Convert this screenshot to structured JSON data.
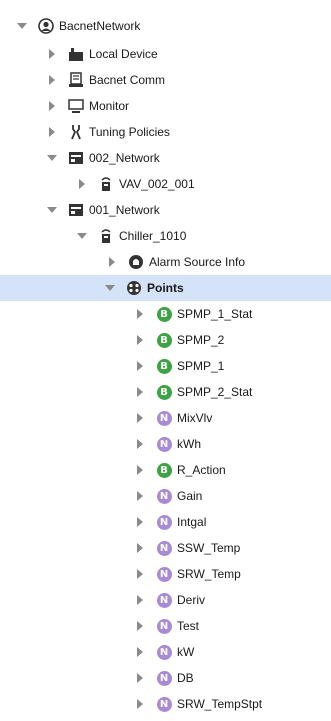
{
  "tree": {
    "rows": [
      {
        "label": "BacnetNetwork",
        "toggle": "expanded",
        "icon": "network-globe-icon"
      },
      {
        "label": "Local Device",
        "toggle": "collapsed",
        "icon": "local-device-icon"
      },
      {
        "label": "Bacnet Comm",
        "toggle": "collapsed",
        "icon": "bacnet-comm-icon"
      },
      {
        "label": "Monitor",
        "toggle": "collapsed",
        "icon": "monitor-icon"
      },
      {
        "label": "Tuning Policies",
        "toggle": "collapsed",
        "icon": "tuning-policies-icon"
      },
      {
        "label": "002_Network",
        "toggle": "expanded",
        "icon": "network-folder-icon"
      },
      {
        "label": "VAV_002_001",
        "toggle": "collapsed",
        "icon": "device-icon"
      },
      {
        "label": "001_Network",
        "toggle": "expanded",
        "icon": "network-folder-icon"
      },
      {
        "label": "Chiller_1010",
        "toggle": "expanded",
        "icon": "device-icon"
      },
      {
        "label": "Alarm Source Info",
        "toggle": "collapsed",
        "icon": "alarm-source-icon"
      },
      {
        "label": "Points",
        "toggle": "expanded",
        "icon": "points-icon",
        "selected": true
      },
      {
        "label": "SPMP_1_Stat",
        "toggle": "collapsed",
        "icon": "B"
      },
      {
        "label": "SPMP_2",
        "toggle": "collapsed",
        "icon": "B"
      },
      {
        "label": "SPMP_1",
        "toggle": "collapsed",
        "icon": "B"
      },
      {
        "label": "SPMP_2_Stat",
        "toggle": "collapsed",
        "icon": "B"
      },
      {
        "label": "MixVlv",
        "toggle": "collapsed",
        "icon": "N"
      },
      {
        "label": "kWh",
        "toggle": "collapsed",
        "icon": "N"
      },
      {
        "label": "R_Action",
        "toggle": "collapsed",
        "icon": "B"
      },
      {
        "label": "Gain",
        "toggle": "collapsed",
        "icon": "N"
      },
      {
        "label": "Intgal",
        "toggle": "collapsed",
        "icon": "N"
      },
      {
        "label": "SSW_Temp",
        "toggle": "collapsed",
        "icon": "N"
      },
      {
        "label": "SRW_Temp",
        "toggle": "collapsed",
        "icon": "N"
      },
      {
        "label": "Deriv",
        "toggle": "collapsed",
        "icon": "N"
      },
      {
        "label": "Test",
        "toggle": "collapsed",
        "icon": "N"
      },
      {
        "label": "kW",
        "toggle": "collapsed",
        "icon": "N"
      },
      {
        "label": "DB",
        "toggle": "collapsed",
        "icon": "N"
      },
      {
        "label": "SRW_TempStpt",
        "toggle": "collapsed",
        "icon": "N"
      }
    ]
  }
}
